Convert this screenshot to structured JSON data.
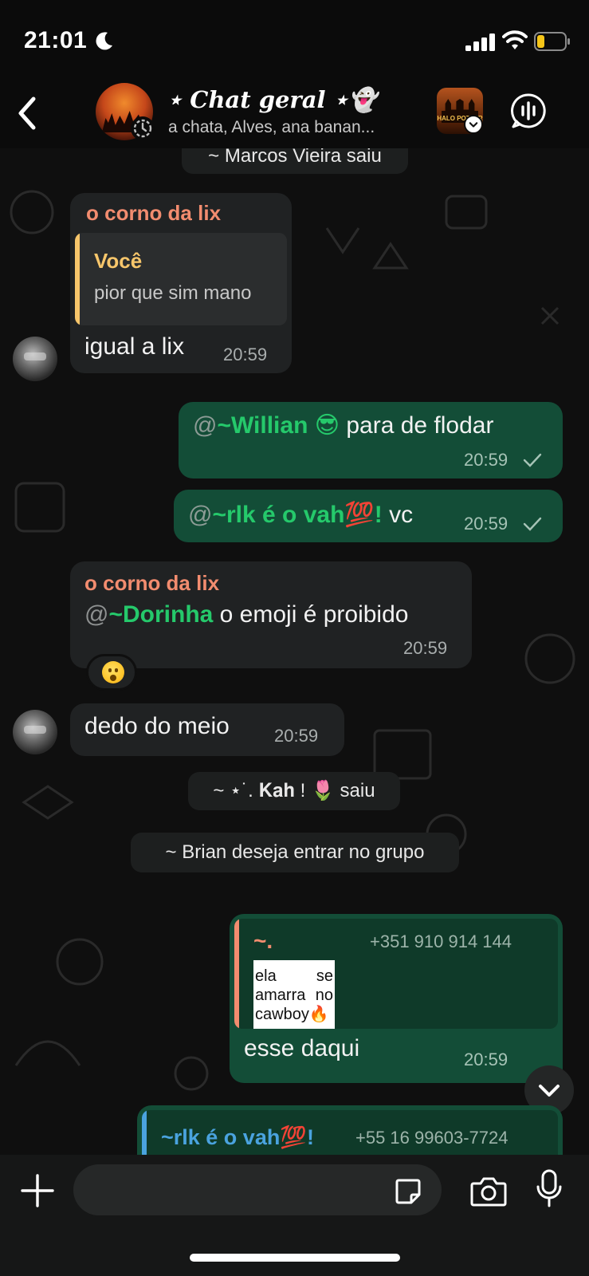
{
  "status_bar": {
    "time": "21:01",
    "icons": [
      "moon-icon",
      "signal-icon",
      "wifi-icon",
      "battery-low-icon"
    ],
    "battery_color": "#f5c518"
  },
  "header": {
    "title": "⋆ Chat geral ⋆👻",
    "subtitle": "a chata, Alves, ana banan...",
    "community_avatar_text": "HALO POTTER",
    "icons": [
      "back-icon",
      "disappearing-timer-icon",
      "community-check-icon",
      "voice-chat-icon"
    ]
  },
  "chat": {
    "system_top": "~ Marcos Vieira saiu",
    "msg1": {
      "sender": "o corno da lix",
      "quote_author": "Você",
      "quote_text": "pior que sim mano",
      "text": "igual a lix",
      "time": "20:59"
    },
    "msg2": {
      "at": "@",
      "mention": "~Willian 😎",
      "text": " para de flodar",
      "time": "20:59"
    },
    "msg3": {
      "at": "@",
      "mention": "~rlk é o vah💯!",
      "text": " vc",
      "time": "20:59"
    },
    "msg4": {
      "sender": "o corno da lix",
      "at": "@",
      "mention": "~Dorinha",
      "text": " o emoji é proibido",
      "time": "20:59",
      "reaction": "😮"
    },
    "msg5": {
      "text": "dedo do meio",
      "time": "20:59"
    },
    "system_kah": "~ ⋆˙. 𝐊𝐚𝐡 ! 🌷  saiu",
    "system_brian": "~ Brian deseja entrar no grupo",
    "msg6": {
      "quote_author": "~.",
      "quote_phone": "+351 910 914 144",
      "sticker_line1_left": "ela",
      "sticker_line1_right": "se",
      "sticker_line2_left": "amarra",
      "sticker_line2_right": "no",
      "sticker_line3": "cawboy🔥",
      "text": "esse daqui",
      "time": "20:59"
    },
    "msg7": {
      "quote_author": "~rlk é o vah💯!",
      "quote_phone": "+55 16 99603-7724"
    }
  },
  "colors": {
    "incoming_bubble": "#202223",
    "outgoing_bubble": "#134d37",
    "sender_name": "#f28c6f",
    "quote_you": "#f7c66b",
    "mention": "#25c96b",
    "quote_blue": "#4aa3df"
  },
  "bottom_bar": {
    "icons": [
      "plus-icon",
      "sticker-icon",
      "camera-icon",
      "mic-icon"
    ],
    "input_placeholder": ""
  }
}
